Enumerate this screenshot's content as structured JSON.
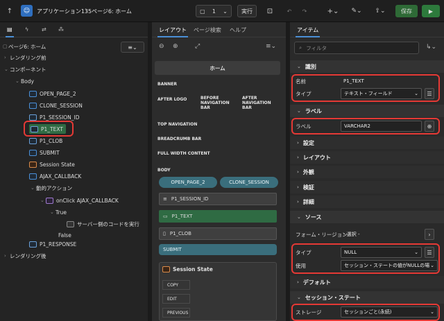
{
  "topbar": {
    "app_name": "アプリケーション135",
    "separator": "\\",
    "page_label": "ページ6: ホーム",
    "page_number": "1",
    "run_page": "実行",
    "save": "保存",
    "add": "+",
    "wrench": "⚙"
  },
  "left": {
    "tree": [
      {
        "label": "ページ6: ホーム",
        "icon": "page-icon"
      },
      {
        "label": "レンダリング前"
      },
      {
        "label": "コンポーネント"
      },
      {
        "label": "Body"
      },
      {
        "label": "OPEN_PAGE_2"
      },
      {
        "label": "CLONE_SESSION"
      },
      {
        "label": "P1_SESSION_ID"
      },
      {
        "label": "P1_TEXT"
      },
      {
        "label": "P1_CLOB"
      },
      {
        "label": "SUBMIT"
      },
      {
        "label": "Session State"
      },
      {
        "label": "AJAX_CALLBACK"
      },
      {
        "label": "動的アクション"
      },
      {
        "label": "onClick AJAX_CALLBACK"
      },
      {
        "label": "True"
      },
      {
        "label": "サーバー側のコードを実行"
      },
      {
        "label": "False"
      },
      {
        "label": "P1_RESPONSE"
      },
      {
        "label": "レンダリング後"
      }
    ]
  },
  "mid": {
    "tabs": [
      "レイアウト",
      "ページ検索",
      "ヘルプ"
    ],
    "home": "ホーム",
    "banner": "BANNER",
    "after_logo": "AFTER LOGO",
    "before_nav": "BEFORE NAVIGATION BAR",
    "after_nav": "AFTER NAVIGATION BAR",
    "top_nav": "TOP NAVIGATION",
    "breadcrumb_bar": "BREADCRUMB BAR",
    "full_width": "FULL WIDTH CONTENT",
    "body": "BODY",
    "btn_open": "OPEN_PAGE_2",
    "btn_clone": "CLONE_SESSION",
    "item_session": "P1_SESSION_ID",
    "item_text": "P1_TEXT",
    "item_clob": "P1_CLOB",
    "btn_submit": "SUBMIT",
    "region": "Session State",
    "copy": "COPY",
    "edit": "EDIT",
    "previous": "PREVIOUS"
  },
  "right": {
    "tab": "アイテム",
    "filter_placeholder": "フィルタ",
    "sec_identify": "識別",
    "name_label": "名前",
    "name_value": "P1_TEXT",
    "type_label": "タイプ",
    "type_value": "テキスト・フィールド",
    "sec_label": "ラベル",
    "label_label": "ラベル",
    "label_value": "VARCHAR2",
    "sec_settings": "設定",
    "sec_layout": "レイアウト",
    "sec_appearance": "外観",
    "sec_validation": "検証",
    "sec_detail": "詳細",
    "sec_source": "ソース",
    "form_region_label": "フォーム・リージョン",
    "form_region_value": "- 選択 -",
    "src_type_label": "タイプ",
    "src_type_value": "NULL",
    "used_label": "使用",
    "used_value": "セッション・ステートの値がNULLの場",
    "sec_default": "デフォルト",
    "sec_session": "セッション・ステート",
    "storage_label": "ストレージ",
    "storage_value": "セッションごと(永続)"
  },
  "colors": {
    "accent": "#4a8fd6",
    "highlight": "#e53935",
    "run": "#2d7a3c"
  }
}
